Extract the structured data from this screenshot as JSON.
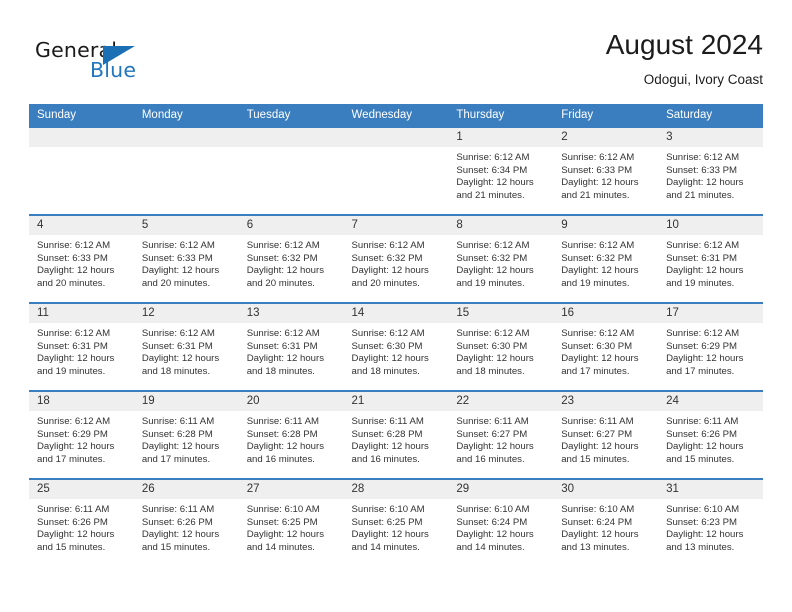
{
  "brand": {
    "name_part1": "General",
    "name_part2": "Blue",
    "flag_icon": "triangle-flag-icon"
  },
  "header": {
    "title": "August 2024",
    "location": "Odogui, Ivory Coast"
  },
  "calendar": {
    "weekday_headers": [
      "Sunday",
      "Monday",
      "Tuesday",
      "Wednesday",
      "Thursday",
      "Friday",
      "Saturday"
    ],
    "accent_color": "#3b7ebf",
    "daynum_band_color": "#efefef",
    "weeks": [
      [
        {
          "day": "",
          "empty": true
        },
        {
          "day": "",
          "empty": true
        },
        {
          "day": "",
          "empty": true
        },
        {
          "day": "",
          "empty": true
        },
        {
          "day": "1",
          "sunrise": "Sunrise: 6:12 AM",
          "sunset": "Sunset: 6:34 PM",
          "daylight1": "Daylight: 12 hours",
          "daylight2": "and 21 minutes."
        },
        {
          "day": "2",
          "sunrise": "Sunrise: 6:12 AM",
          "sunset": "Sunset: 6:33 PM",
          "daylight1": "Daylight: 12 hours",
          "daylight2": "and 21 minutes."
        },
        {
          "day": "3",
          "sunrise": "Sunrise: 6:12 AM",
          "sunset": "Sunset: 6:33 PM",
          "daylight1": "Daylight: 12 hours",
          "daylight2": "and 21 minutes."
        }
      ],
      [
        {
          "day": "4",
          "sunrise": "Sunrise: 6:12 AM",
          "sunset": "Sunset: 6:33 PM",
          "daylight1": "Daylight: 12 hours",
          "daylight2": "and 20 minutes."
        },
        {
          "day": "5",
          "sunrise": "Sunrise: 6:12 AM",
          "sunset": "Sunset: 6:33 PM",
          "daylight1": "Daylight: 12 hours",
          "daylight2": "and 20 minutes."
        },
        {
          "day": "6",
          "sunrise": "Sunrise: 6:12 AM",
          "sunset": "Sunset: 6:32 PM",
          "daylight1": "Daylight: 12 hours",
          "daylight2": "and 20 minutes."
        },
        {
          "day": "7",
          "sunrise": "Sunrise: 6:12 AM",
          "sunset": "Sunset: 6:32 PM",
          "daylight1": "Daylight: 12 hours",
          "daylight2": "and 20 minutes."
        },
        {
          "day": "8",
          "sunrise": "Sunrise: 6:12 AM",
          "sunset": "Sunset: 6:32 PM",
          "daylight1": "Daylight: 12 hours",
          "daylight2": "and 19 minutes."
        },
        {
          "day": "9",
          "sunrise": "Sunrise: 6:12 AM",
          "sunset": "Sunset: 6:32 PM",
          "daylight1": "Daylight: 12 hours",
          "daylight2": "and 19 minutes."
        },
        {
          "day": "10",
          "sunrise": "Sunrise: 6:12 AM",
          "sunset": "Sunset: 6:31 PM",
          "daylight1": "Daylight: 12 hours",
          "daylight2": "and 19 minutes."
        }
      ],
      [
        {
          "day": "11",
          "sunrise": "Sunrise: 6:12 AM",
          "sunset": "Sunset: 6:31 PM",
          "daylight1": "Daylight: 12 hours",
          "daylight2": "and 19 minutes."
        },
        {
          "day": "12",
          "sunrise": "Sunrise: 6:12 AM",
          "sunset": "Sunset: 6:31 PM",
          "daylight1": "Daylight: 12 hours",
          "daylight2": "and 18 minutes."
        },
        {
          "day": "13",
          "sunrise": "Sunrise: 6:12 AM",
          "sunset": "Sunset: 6:31 PM",
          "daylight1": "Daylight: 12 hours",
          "daylight2": "and 18 minutes."
        },
        {
          "day": "14",
          "sunrise": "Sunrise: 6:12 AM",
          "sunset": "Sunset: 6:30 PM",
          "daylight1": "Daylight: 12 hours",
          "daylight2": "and 18 minutes."
        },
        {
          "day": "15",
          "sunrise": "Sunrise: 6:12 AM",
          "sunset": "Sunset: 6:30 PM",
          "daylight1": "Daylight: 12 hours",
          "daylight2": "and 18 minutes."
        },
        {
          "day": "16",
          "sunrise": "Sunrise: 6:12 AM",
          "sunset": "Sunset: 6:30 PM",
          "daylight1": "Daylight: 12 hours",
          "daylight2": "and 17 minutes."
        },
        {
          "day": "17",
          "sunrise": "Sunrise: 6:12 AM",
          "sunset": "Sunset: 6:29 PM",
          "daylight1": "Daylight: 12 hours",
          "daylight2": "and 17 minutes."
        }
      ],
      [
        {
          "day": "18",
          "sunrise": "Sunrise: 6:12 AM",
          "sunset": "Sunset: 6:29 PM",
          "daylight1": "Daylight: 12 hours",
          "daylight2": "and 17 minutes."
        },
        {
          "day": "19",
          "sunrise": "Sunrise: 6:11 AM",
          "sunset": "Sunset: 6:28 PM",
          "daylight1": "Daylight: 12 hours",
          "daylight2": "and 17 minutes."
        },
        {
          "day": "20",
          "sunrise": "Sunrise: 6:11 AM",
          "sunset": "Sunset: 6:28 PM",
          "daylight1": "Daylight: 12 hours",
          "daylight2": "and 16 minutes."
        },
        {
          "day": "21",
          "sunrise": "Sunrise: 6:11 AM",
          "sunset": "Sunset: 6:28 PM",
          "daylight1": "Daylight: 12 hours",
          "daylight2": "and 16 minutes."
        },
        {
          "day": "22",
          "sunrise": "Sunrise: 6:11 AM",
          "sunset": "Sunset: 6:27 PM",
          "daylight1": "Daylight: 12 hours",
          "daylight2": "and 16 minutes."
        },
        {
          "day": "23",
          "sunrise": "Sunrise: 6:11 AM",
          "sunset": "Sunset: 6:27 PM",
          "daylight1": "Daylight: 12 hours",
          "daylight2": "and 15 minutes."
        },
        {
          "day": "24",
          "sunrise": "Sunrise: 6:11 AM",
          "sunset": "Sunset: 6:26 PM",
          "daylight1": "Daylight: 12 hours",
          "daylight2": "and 15 minutes."
        }
      ],
      [
        {
          "day": "25",
          "sunrise": "Sunrise: 6:11 AM",
          "sunset": "Sunset: 6:26 PM",
          "daylight1": "Daylight: 12 hours",
          "daylight2": "and 15 minutes."
        },
        {
          "day": "26",
          "sunrise": "Sunrise: 6:11 AM",
          "sunset": "Sunset: 6:26 PM",
          "daylight1": "Daylight: 12 hours",
          "daylight2": "and 15 minutes."
        },
        {
          "day": "27",
          "sunrise": "Sunrise: 6:10 AM",
          "sunset": "Sunset: 6:25 PM",
          "daylight1": "Daylight: 12 hours",
          "daylight2": "and 14 minutes."
        },
        {
          "day": "28",
          "sunrise": "Sunrise: 6:10 AM",
          "sunset": "Sunset: 6:25 PM",
          "daylight1": "Daylight: 12 hours",
          "daylight2": "and 14 minutes."
        },
        {
          "day": "29",
          "sunrise": "Sunrise: 6:10 AM",
          "sunset": "Sunset: 6:24 PM",
          "daylight1": "Daylight: 12 hours",
          "daylight2": "and 14 minutes."
        },
        {
          "day": "30",
          "sunrise": "Sunrise: 6:10 AM",
          "sunset": "Sunset: 6:24 PM",
          "daylight1": "Daylight: 12 hours",
          "daylight2": "and 13 minutes."
        },
        {
          "day": "31",
          "sunrise": "Sunrise: 6:10 AM",
          "sunset": "Sunset: 6:23 PM",
          "daylight1": "Daylight: 12 hours",
          "daylight2": "and 13 minutes."
        }
      ]
    ]
  }
}
